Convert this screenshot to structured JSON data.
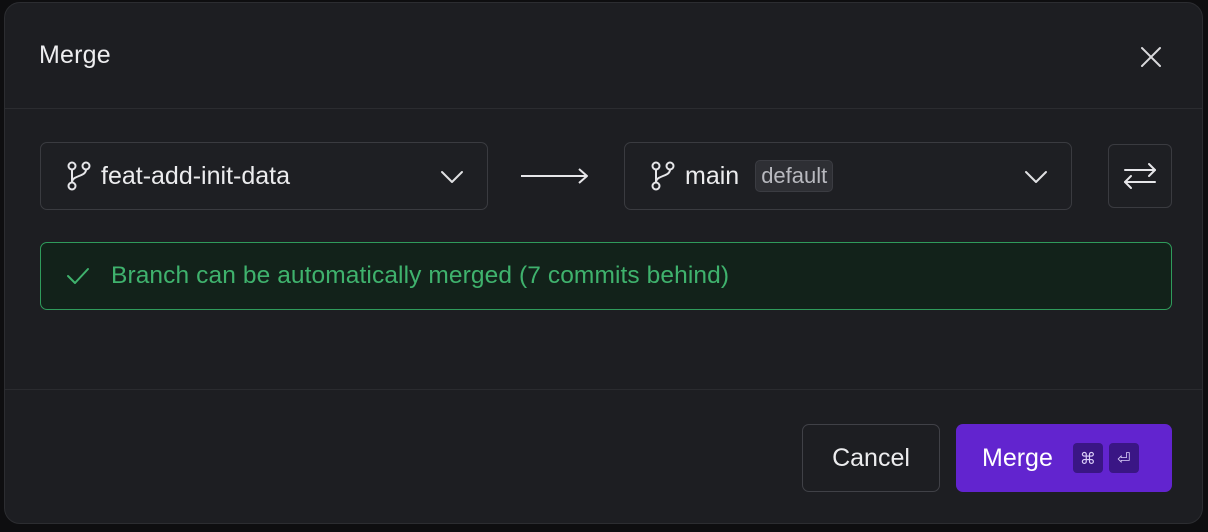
{
  "dialog": {
    "title": "Merge"
  },
  "source_branch": {
    "name": "feat-add-init-data"
  },
  "target_branch": {
    "name": "main",
    "badge": "default"
  },
  "status": {
    "text": "Branch can be automatically merged (7 commits behind)"
  },
  "actions": {
    "cancel_label": "Cancel",
    "merge_label": "Merge",
    "shortcut_keys": [
      "⌘",
      "⏎"
    ]
  },
  "icons": {
    "close": "close-icon",
    "branch": "git-branch-icon",
    "chevron": "chevron-down-icon",
    "arrow": "arrow-right-icon",
    "swap": "swap-arrows-icon",
    "check": "check-icon"
  },
  "colors": {
    "accent": "#6224cf",
    "success": "#3fb26d",
    "success_bg": "#12221a"
  }
}
